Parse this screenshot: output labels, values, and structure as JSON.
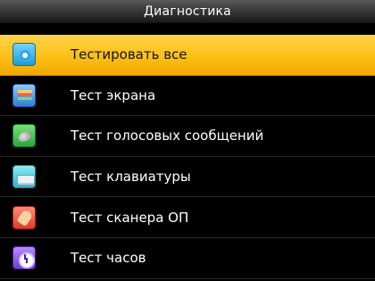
{
  "header": {
    "title": "Диагностика"
  },
  "menu": {
    "items": [
      {
        "label": "Тестировать все",
        "icon": "test-all-icon",
        "selected": true
      },
      {
        "label": "Тест экрана",
        "icon": "screen-test-icon",
        "selected": false
      },
      {
        "label": "Тест голосовых сообщений",
        "icon": "voice-test-icon",
        "selected": false
      },
      {
        "label": "Тест клавиатуры",
        "icon": "keyboard-test-icon",
        "selected": false
      },
      {
        "label": "Тест сканера ОП",
        "icon": "fingerprint-scanner-icon",
        "selected": false
      },
      {
        "label": "Тест часов",
        "icon": "clock-test-icon",
        "selected": false
      }
    ]
  },
  "colors": {
    "background": "#000000",
    "selected_row": "#ffc21a",
    "header": "#3a3a3a",
    "text": "#ffffff"
  }
}
